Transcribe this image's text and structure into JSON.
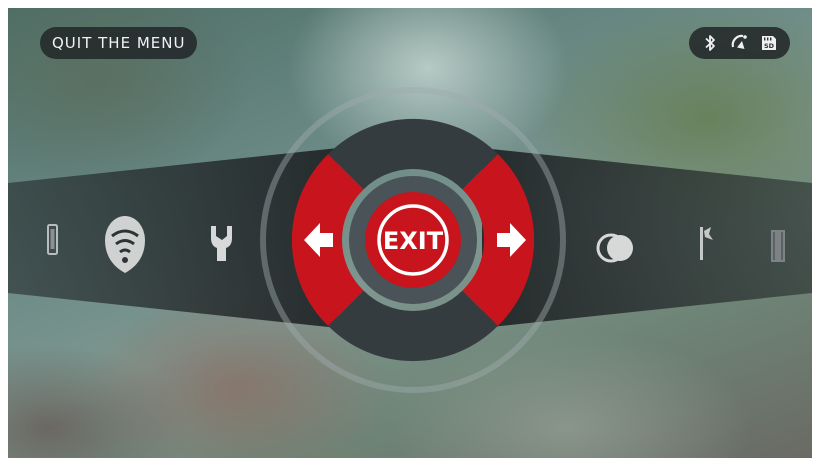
{
  "header": {
    "quit_label": "QUIT THE MENU"
  },
  "status_bar": {
    "icons": [
      "bluetooth-icon",
      "wifi-signal-icon",
      "sd-card-icon"
    ],
    "sd_label": "SD"
  },
  "menu": {
    "center_label": "EXIT",
    "left_items": [
      "phone-icon",
      "wifi-hotspot-icon",
      "wrench-icon"
    ],
    "right_items": [
      "color-mode-icon",
      "flag-icon",
      "film-icon"
    ]
  },
  "colors": {
    "accent_red": "#c8141c",
    "ring_dark": "#3a4145",
    "band_dark": "#2a2e30",
    "icon_light": "#d7d8d8"
  }
}
